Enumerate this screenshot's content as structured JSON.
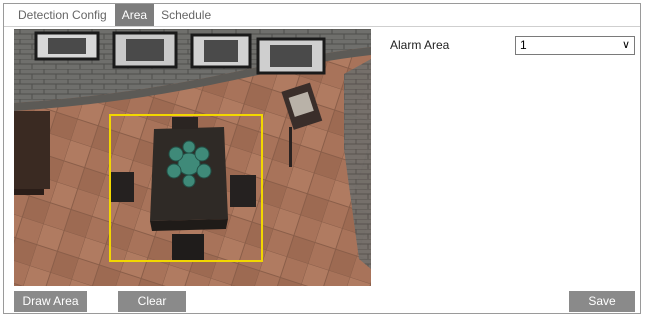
{
  "tabs": [
    {
      "label": "Detection Config",
      "active": false
    },
    {
      "label": "Area",
      "active": true
    },
    {
      "label": "Schedule",
      "active": false
    }
  ],
  "alarm_area": {
    "label": "Alarm Area",
    "selected": "1"
  },
  "buttons": {
    "draw_area": "Draw Area",
    "clear": "Clear",
    "save": "Save"
  },
  "colors": {
    "area_outline": "#f2d700",
    "button_bg": "#8a8a8a",
    "active_tab_bg": "#7d7d7d"
  },
  "icons": {
    "select_chevron": "chevron-down-icon"
  }
}
